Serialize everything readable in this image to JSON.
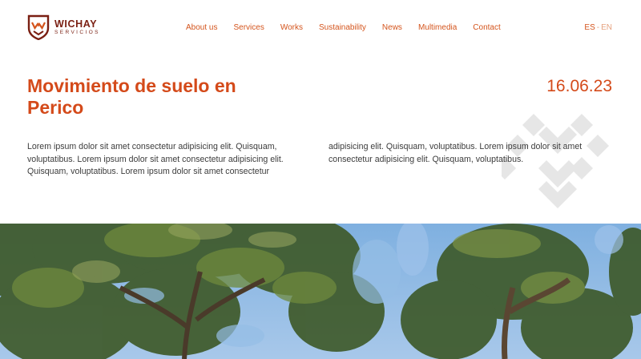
{
  "brand": {
    "name": "WICHAY",
    "subtitle": "SERVICIOS",
    "color": "#7a1f12"
  },
  "nav": {
    "items": [
      "About us",
      "Services",
      "Works",
      "Sustainability",
      "News",
      "Multimedia",
      "Contact"
    ]
  },
  "lang": {
    "active": "ES",
    "separator": "-",
    "inactive": "EN"
  },
  "article": {
    "title": "Movimiento de suelo en Perico",
    "date": "16.06.23",
    "column_1": "Lorem ipsum dolor sit amet consectetur adipisicing elit. Quisquam, voluptatibus. Lorem ipsum dolor sit amet consectetur adipisicing elit. Quisquam, voluptatibus. Lorem ipsum dolor sit amet consectetur",
    "column_2": "adipisicing elit. Quisquam, voluptatibus. Lorem ipsum dolor sit amet consectetur adipisicing elit. Quisquam, voluptatibus."
  },
  "hero": {
    "icon": "tree-canopy-photo"
  },
  "colors": {
    "accent": "#d44a1a",
    "nav": "#d4541c",
    "inactive_lang": "#e6a27f",
    "watermark": "#e6e6e6",
    "sky": "#8fb8e0"
  }
}
